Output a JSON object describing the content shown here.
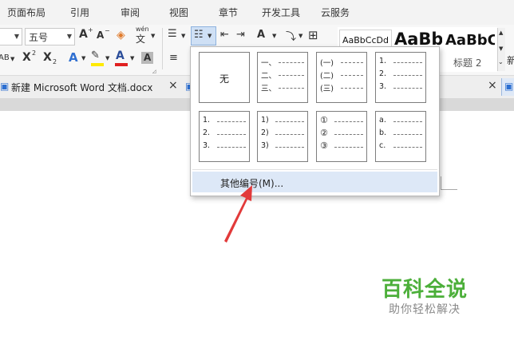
{
  "menubar": {
    "items": [
      "页面布局",
      "引用",
      "审阅",
      "视图",
      "章节",
      "开发工具",
      "云服务"
    ]
  },
  "ribbon": {
    "font_size_value": "五号",
    "grow_font": "A",
    "shrink_font": "A",
    "pinyin": "wén",
    "char_a": "A",
    "superscript": "X",
    "subscript": "X",
    "hue_ab": "AB",
    "style_samples": [
      "AaBbCcDd",
      "AaBb",
      "AaBbC"
    ],
    "style_caption": "标题 2",
    "new_label": "新"
  },
  "tabbar": {
    "doc_tab_label": "新建 Microsoft Word 文档.docx",
    "close_glyph": "×"
  },
  "dropdown": {
    "none_label": "无",
    "cells": [
      {
        "lines": [
          "一、",
          "二、",
          "三、"
        ]
      },
      {
        "lines": [
          "(一)",
          "(二)",
          "(三)"
        ]
      },
      {
        "lines": [
          "1.",
          "2.",
          "3."
        ]
      },
      {
        "lines": [
          "1.",
          "2.",
          "3."
        ]
      },
      {
        "lines": [
          "1)",
          "2)",
          "3)"
        ]
      },
      {
        "lines": [
          "①",
          "②",
          "③"
        ]
      },
      {
        "lines": [
          "a.",
          "b.",
          "c."
        ]
      }
    ],
    "more_label": "其他编号(M)..."
  },
  "watermark": {
    "title": "百科全说",
    "subtitle": "助你轻松解决"
  },
  "colors": {
    "accent_red": "#e23a3a",
    "watermark_green": "#4caf3a",
    "highlight_yellow": "#ffea00",
    "font_red": "#e02020",
    "selected_bg": "#dde8f7",
    "letter_blue": "#2f6fd1"
  }
}
